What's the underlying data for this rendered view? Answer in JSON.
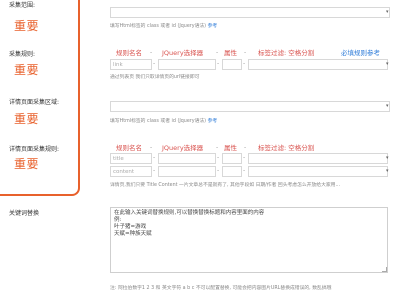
{
  "fields": {
    "range": {
      "label": "采集范围:",
      "required": "重要"
    },
    "rules": {
      "label": "采集规则:",
      "required": "重要"
    },
    "detail_area": {
      "label": "详情页面采集区域:",
      "required": "重要"
    },
    "detail_rules": {
      "label": "详情页面采集规则:",
      "required": "重要"
    },
    "keyword": {
      "label": "关键词替换"
    }
  },
  "range_help": {
    "text": "填写Html标签的 class 或者 id (Jquery语法)",
    "link": "参考"
  },
  "rules_header": {
    "name": "规则名名",
    "selector": "JQuery选择器",
    "attr": "属性",
    "filter": "标签过滤: 空格分割",
    "required_ref": "必填规则参考"
  },
  "rules_row": {
    "name_value": "link"
  },
  "rules_help": "通过列表页 我们只取详情页的url链接即可",
  "detail_area_help": {
    "text": "填写Html标签的 class 或者 id (Jquery语法)",
    "link": "参考"
  },
  "detail_header": {
    "name": "规则名名",
    "selector": "JQuery选择器",
    "attr": "属性",
    "filter": "标签过滤: 空格分割"
  },
  "detail_rows": [
    {
      "name_value": "title"
    },
    {
      "name_value": "content"
    }
  ],
  "detail_help": "详情页,我们只要 Title Content 一片文章总不是就有了, 其他字段如 日期/作者 回头考虑怎么开放给大家用...",
  "keyword_textarea": "在此输入关键词替换规则,可以替换替换标题和内容里面的内容\n例:\n叶子猪=游戏\n天赋=种族天赋",
  "keyword_help": "注: 阿拉伯数字1 2 3 和 英文字符 a b c 不可以配置替换, 可能会把内容图片URL替换成错误的, 数乱搞哦",
  "colors": {
    "accent": "#e8612c",
    "link": "#2d7bd8",
    "header_red": "#d9534f"
  }
}
